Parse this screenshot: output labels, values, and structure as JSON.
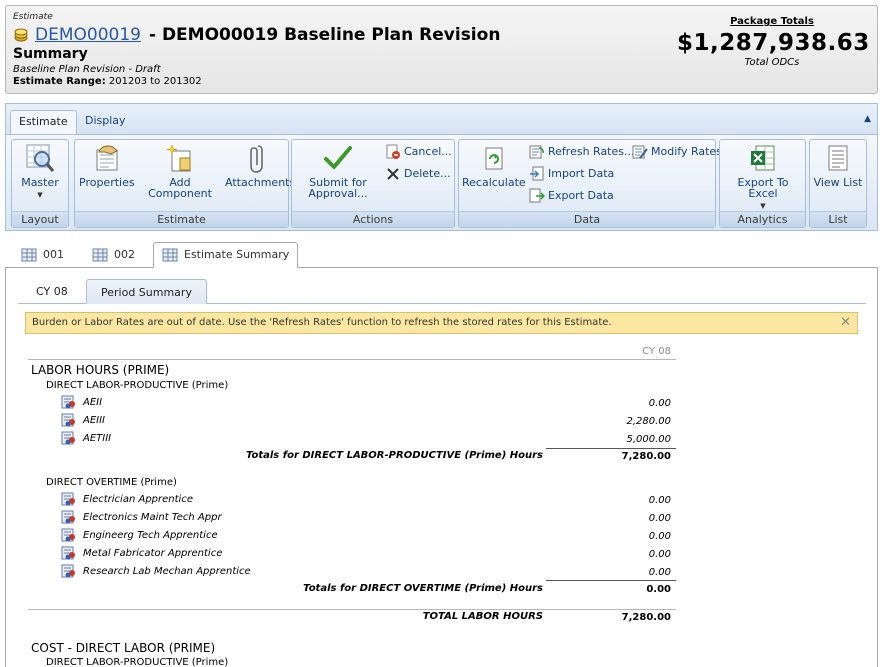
{
  "header": {
    "crumb": "Estimate",
    "estimate_id": "DEMO00019",
    "estimate_title": "- DEMO00019 Baseline Plan Revision",
    "section_title": "Summary",
    "status": "Baseline Plan Revision - Draft",
    "range_label": "Estimate Range:",
    "range_value": "201203 to 201302",
    "package_totals_label": "Package Totals",
    "package_total": "$1,287,938.63",
    "package_total_sub": "Total ODCs"
  },
  "ribbon": {
    "tabs": [
      "Estimate",
      "Display"
    ],
    "groups": {
      "layout": {
        "label": "Layout",
        "master": "Master"
      },
      "estimate": {
        "label": "Estimate",
        "properties": "Properties",
        "add_component": "Add Component",
        "attachments": "Attachments"
      },
      "actions": {
        "label": "Actions",
        "submit_line1": "Submit for",
        "submit_line2": "Approval...",
        "cancel": "Cancel...",
        "delete": "Delete..."
      },
      "data": {
        "label": "Data",
        "recalculate": "Recalculate",
        "refresh_rates": "Refresh Rates...",
        "modify_rates": "Modify Rates",
        "import_data": "Import Data",
        "export_data": "Export Data"
      },
      "analytics": {
        "label": "Analytics",
        "export_excel": "Export To Excel"
      },
      "list": {
        "label": "List",
        "view_list": "View List"
      }
    }
  },
  "outer_tabs": [
    "001",
    "002",
    "Estimate Summary"
  ],
  "inner_tabs": [
    "CY 08",
    "Period Summary"
  ],
  "alert": {
    "text": "Burden or Labor Rates are out of date. Use the 'Refresh Rates' function to refresh the stored rates for this Estimate.",
    "close": "✕"
  },
  "report": {
    "column_header": "CY 08",
    "labor_hours_title": "LABOR HOURS (PRIME)",
    "dlp_title": "DIRECT LABOR-PRODUCTIVE (Prime)",
    "dlp_items": [
      {
        "name": "AEII",
        "value": "0.00"
      },
      {
        "name": "AEIII",
        "value": "2,280.00"
      },
      {
        "name": "AETIII",
        "value": "5,000.00"
      }
    ],
    "dlp_total_label": "Totals for DIRECT LABOR-PRODUCTIVE (Prime) Hours",
    "dlp_total_value": "7,280.00",
    "dot_title": "DIRECT OVERTIME (Prime)",
    "dot_items": [
      {
        "name": "Electrician Apprentice",
        "value": "0.00"
      },
      {
        "name": "Electronics Maint Tech Appr",
        "value": "0.00"
      },
      {
        "name": "Engineerg Tech Apprentice",
        "value": "0.00"
      },
      {
        "name": "Metal Fabricator Apprentice",
        "value": "0.00"
      },
      {
        "name": "Research Lab Mechan Apprentice",
        "value": "0.00"
      }
    ],
    "dot_total_label": "Totals for DIRECT OVERTIME (Prime) Hours",
    "dot_total_value": "0.00",
    "total_labor_label": "TOTAL LABOR HOURS",
    "total_labor_value": "7,280.00",
    "cost_title": "COST - DIRECT LABOR (PRIME)",
    "cost_sub": "DIRECT LABOR-PRODUCTIVE (Prime)"
  }
}
